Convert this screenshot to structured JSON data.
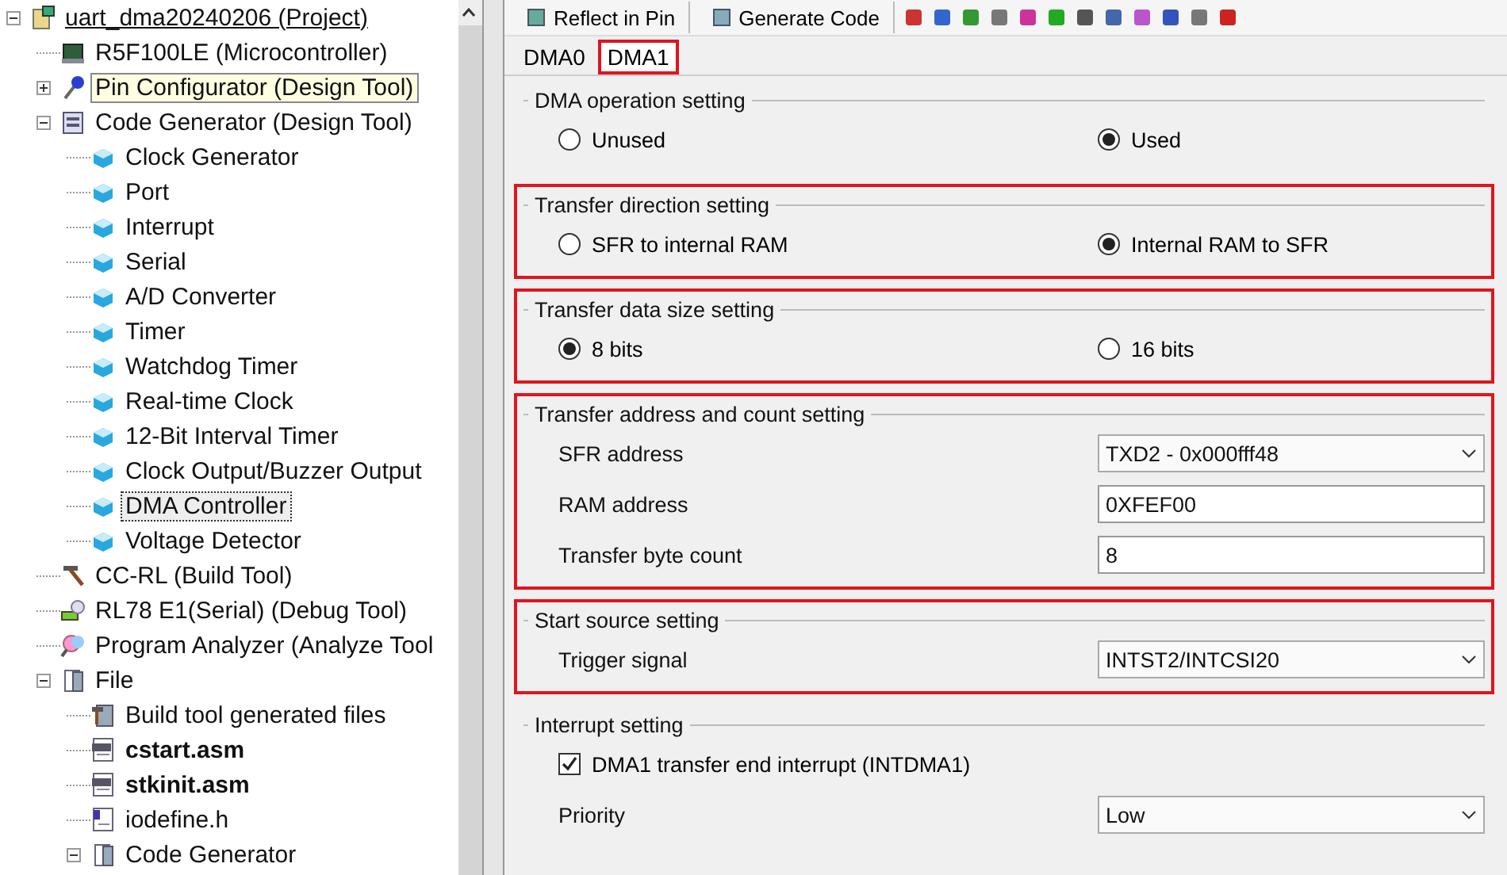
{
  "project_tree": {
    "items": [
      {
        "kind": "project",
        "label": "uart_dma20240206 (Project)",
        "expanded": true,
        "selected": false,
        "children": [
          {
            "kind": "chip",
            "label": "R5F100LE (Microcontroller)",
            "selected": false,
            "hovered": false
          },
          {
            "kind": "pin",
            "label": "Pin Configurator (Design Tool)",
            "expanded": false,
            "selected": false,
            "hovered": true
          },
          {
            "kind": "codegen",
            "label": "Code Generator (Design Tool)",
            "expanded": true,
            "selected": false,
            "hovered": false,
            "children": [
              {
                "kind": "cube",
                "label": "Clock Generator",
                "selected": false
              },
              {
                "kind": "cube",
                "label": "Port",
                "selected": false
              },
              {
                "kind": "cube",
                "label": "Interrupt",
                "selected": false
              },
              {
                "kind": "cube",
                "label": "Serial",
                "selected": false
              },
              {
                "kind": "cube",
                "label": "A/D Converter",
                "selected": false
              },
              {
                "kind": "cube",
                "label": "Timer",
                "selected": false
              },
              {
                "kind": "cube",
                "label": "Watchdog Timer",
                "selected": false
              },
              {
                "kind": "cube",
                "label": "Real-time Clock",
                "selected": false
              },
              {
                "kind": "cube",
                "label": "12-Bit Interval Timer",
                "selected": false
              },
              {
                "kind": "cube",
                "label": "Clock Output/Buzzer Output",
                "selected": false
              },
              {
                "kind": "cube",
                "label": "DMA Controller",
                "selected": true
              },
              {
                "kind": "cube",
                "label": "Voltage Detector",
                "selected": false
              }
            ]
          },
          {
            "kind": "hammer",
            "label": "CC-RL (Build Tool)",
            "selected": false,
            "hovered": false
          },
          {
            "kind": "debug",
            "label": "RL78 E1(Serial) (Debug Tool)",
            "selected": false,
            "hovered": false
          },
          {
            "kind": "analyzer",
            "label": "Program Analyzer (Analyze Tool",
            "selected": false,
            "hovered": false
          },
          {
            "kind": "folder",
            "label": "File",
            "expanded": true,
            "selected": false,
            "hovered": false,
            "children": [
              {
                "kind": "buildfiles",
                "label": "Build tool generated files",
                "selected": false,
                "bold": false
              },
              {
                "kind": "asm",
                "label": "cstart.asm",
                "selected": false,
                "bold": true
              },
              {
                "kind": "asm",
                "label": "stkinit.asm",
                "selected": false,
                "bold": true
              },
              {
                "kind": "header",
                "label": "iodefine.h",
                "selected": false,
                "bold": false
              },
              {
                "kind": "folder",
                "label": "Code Generator",
                "expanded": true,
                "selected": false,
                "bold": false
              }
            ]
          }
        ]
      }
    ]
  },
  "toolbar": {
    "buttons": [
      "Reflect in Pin",
      "Generate Code"
    ]
  },
  "tabs": [
    {
      "label": "DMA0",
      "selected": false,
      "highlighted": false
    },
    {
      "label": "DMA1",
      "selected": true,
      "highlighted": true
    }
  ],
  "sections": [
    {
      "title": "DMA operation setting",
      "highlighted": false,
      "rows": [
        {
          "kind": "radios",
          "options": [
            {
              "label": "Unused",
              "selected": false
            },
            {
              "label": "Used",
              "selected": true
            }
          ]
        }
      ]
    },
    {
      "title": "Transfer direction setting",
      "highlighted": true,
      "rows": [
        {
          "kind": "radios",
          "options": [
            {
              "label": "SFR to internal RAM",
              "selected": false
            },
            {
              "label": "Internal RAM to SFR",
              "selected": true
            }
          ]
        }
      ]
    },
    {
      "title": "Transfer data size setting",
      "highlighted": true,
      "rows": [
        {
          "kind": "radios",
          "options": [
            {
              "label": "8 bits",
              "selected": true
            },
            {
              "label": "16 bits",
              "selected": false
            }
          ]
        }
      ]
    },
    {
      "title": "Transfer address and count setting",
      "highlighted": true,
      "rows": [
        {
          "kind": "select",
          "label": "SFR address",
          "value": "TXD2 - 0x000fff48"
        },
        {
          "kind": "input",
          "label": "RAM address",
          "value": "0XFEF00"
        },
        {
          "kind": "input",
          "label": "Transfer byte count",
          "value": "8"
        }
      ]
    },
    {
      "title": "Start source setting",
      "highlighted": true,
      "rows": [
        {
          "kind": "select",
          "label": "Trigger signal",
          "value": "INTST2/INTCSI20"
        }
      ]
    },
    {
      "title": "Interrupt setting",
      "highlighted": false,
      "rows": [
        {
          "kind": "checkbox",
          "label": "DMA1 transfer end interrupt (INTDMA1)",
          "checked": true
        },
        {
          "kind": "select",
          "label": "Priority",
          "value": "Low"
        }
      ]
    }
  ]
}
